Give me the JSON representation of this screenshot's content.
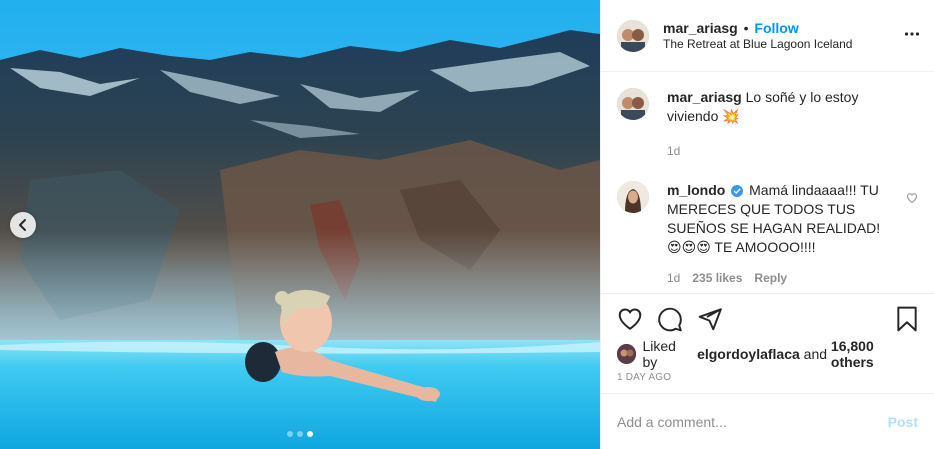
{
  "post": {
    "author": "mar_ariasg",
    "separator": "•",
    "follow_label": "Follow",
    "location": "The Retreat at Blue Lagoon Iceland"
  },
  "photo": {
    "carousel_count": 3,
    "active_index": 3,
    "prev_icon": "chevron-left-icon"
  },
  "comments": [
    {
      "username": "mar_ariasg",
      "text": "Lo soñé y lo estoy viviendo 💥",
      "age": "1d"
    },
    {
      "username": "m_londo",
      "verified": true,
      "text": "Mamá lindaaaa!!! TU MERECES QUE TODOS TUS SUEÑOS SE HAGAN REALIDAD! 😍😍😍 TE AMOOOO!!!!",
      "age": "1d",
      "likes": "235 likes",
      "reply_label": "Reply"
    }
  ],
  "actions": {
    "icons": [
      "heart-icon",
      "comment-icon",
      "share-icon",
      "bookmark-icon"
    ]
  },
  "likes": {
    "prefix": "Liked by",
    "user": "elgordoylaflaca",
    "connector": "and",
    "others": "16,800 others"
  },
  "timestamp": "1 DAY AGO",
  "composer": {
    "placeholder": "Add a comment...",
    "post_label": "Post"
  },
  "colors": {
    "accent": "#0095f6",
    "post_disabled": "#b2dffc",
    "muted": "#8e8e8e"
  }
}
